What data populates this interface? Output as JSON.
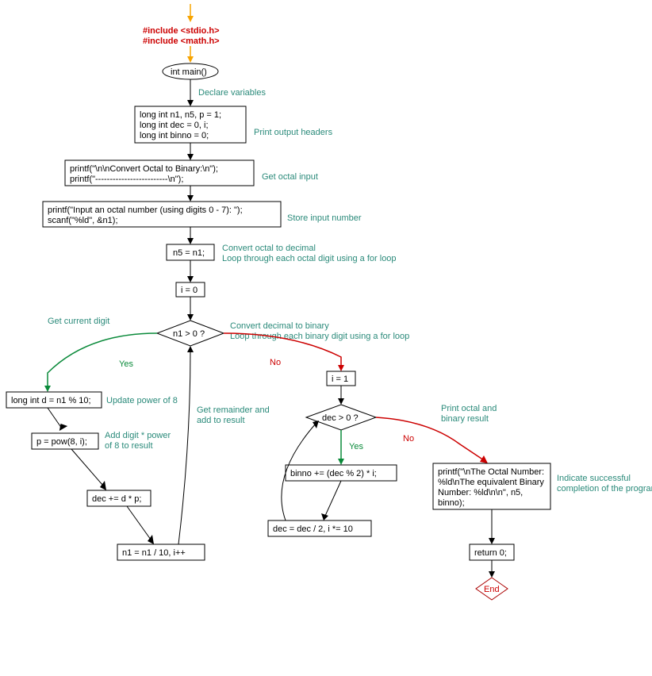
{
  "nodes": {
    "include1": "#include <stdio.h>",
    "include2": "#include <math.h>",
    "main": "int main()",
    "declare1": "long int n1, n5, p = 1;",
    "declare2": "long int dec = 0, i;",
    "declare3": "long int binno = 0;",
    "printf_header1": "printf(\"\\n\\nConvert Octal to Binary:\\n\");",
    "printf_header2": "printf(\"-------------------------\\n\");",
    "printf_input": "printf(\"Input an octal number (using digits 0 - 7): \");",
    "scanf": "scanf(\"%ld\", &n1);",
    "store": "n5 = n1;",
    "i0": "i = 0",
    "cond1": "n1 > 0 ?",
    "get_digit": "long int d = n1 % 10;",
    "pow": "p = pow(8, i);",
    "dec_add": "dec += d * p;",
    "loop_upd": "n1 = n1 / 10, i++",
    "i1": "i = 1",
    "cond2": "dec > 0 ?",
    "binno_add": "binno += (dec % 2) * i;",
    "dec_upd": "dec = dec / 2, i *= 10",
    "printf_result1": "printf(\"\\nThe Octal Number:",
    "printf_result2": "%ld\\nThe equivalent Binary",
    "printf_result3": "Number: %ld\\n\\n\", n5,",
    "printf_result4": "binno);",
    "return0": "return 0;",
    "end": "End"
  },
  "comments": {
    "declare_vars": "Declare variables",
    "print_headers": "Print output headers",
    "get_input": "Get octal input",
    "store_input": "Store input number",
    "convert_decimal": "Convert octal to decimal",
    "loop_octal": "Loop through each octal digit using a for loop",
    "get_digit": "Get current digit",
    "update_pow": "Update power of 8",
    "add_digit": "Add digit * power",
    "add_digit2": "of 8 to result",
    "convert_binary": "Convert decimal to binary",
    "loop_binary": "Loop through each binary digit using a for loop",
    "get_rem": "Get remainder and",
    "get_rem2": "add to result",
    "print_result": "Print octal and",
    "print_result2": "binary result",
    "success1": "Indicate successful",
    "success2": "completion of the program"
  },
  "branches": {
    "yes": "Yes",
    "no": "No"
  }
}
